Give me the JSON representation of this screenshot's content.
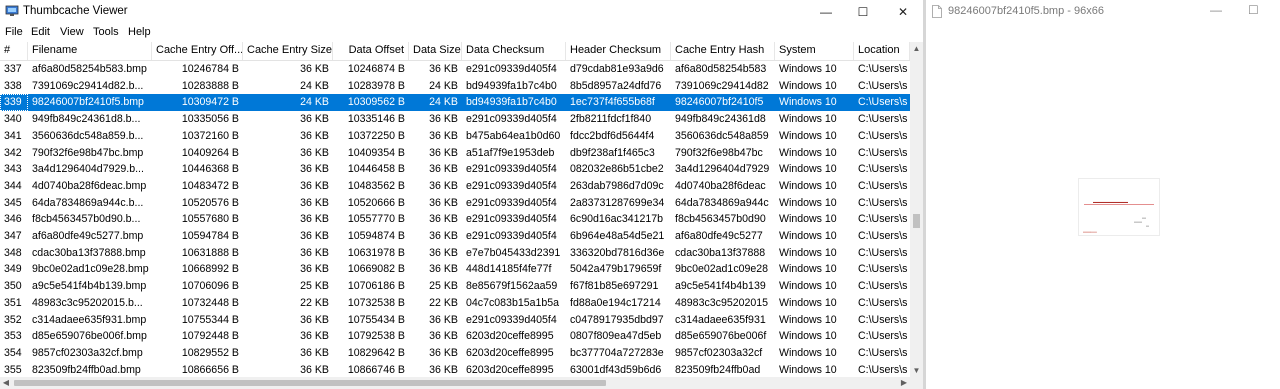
{
  "window": {
    "title": "Thumbcache Viewer",
    "minimize": "—",
    "maximize": "☐",
    "close": "✕"
  },
  "menu": [
    "File",
    "Edit",
    "View",
    "Tools",
    "Help"
  ],
  "columns": [
    "#",
    "Filename",
    "Cache Entry Off...",
    "Cache Entry Size",
    "Data Offset",
    "Data Size",
    "Data Checksum",
    "Header Checksum",
    "Cache Entry Hash",
    "System",
    "Location"
  ],
  "rows": [
    [
      "337",
      "af6a80d58254b583.bmp",
      "10246784 B",
      "36 KB",
      "10246874 B",
      "36 KB",
      "e291c09339d405f4",
      "d79cdab81e93a9d6",
      "af6a80d58254b583",
      "Windows 10",
      "C:\\Users\\s"
    ],
    [
      "338",
      "7391069c29414d82.b...",
      "10283888 B",
      "24 KB",
      "10283978 B",
      "24 KB",
      "bd94939fa1b7c4b0",
      "8b5d8957a24dfd76",
      "7391069c29414d82",
      "Windows 10",
      "C:\\Users\\s"
    ],
    [
      "339",
      "98246007bf2410f5.bmp",
      "10309472 B",
      "24 KB",
      "10309562 B",
      "24 KB",
      "bd94939fa1b7c4b0",
      "1ec737f4f655b68f",
      "98246007bf2410f5",
      "Windows 10",
      "C:\\Users\\s"
    ],
    [
      "340",
      "949fb849c24361d8.b...",
      "10335056 B",
      "36 KB",
      "10335146 B",
      "36 KB",
      "e291c09339d405f4",
      "2fb8211fdcf1f840",
      "949fb849c24361d8",
      "Windows 10",
      "C:\\Users\\s"
    ],
    [
      "341",
      "3560636dc548a859.b...",
      "10372160 B",
      "36 KB",
      "10372250 B",
      "36 KB",
      "b475ab64ea1b0d60",
      "fdcc2bdf6d5644f4",
      "3560636dc548a859",
      "Windows 10",
      "C:\\Users\\s"
    ],
    [
      "342",
      "790f32f6e98b47bc.bmp",
      "10409264 B",
      "36 KB",
      "10409354 B",
      "36 KB",
      "a51af7f9e1953deb",
      "db9f238af1f465c3",
      "790f32f6e98b47bc",
      "Windows 10",
      "C:\\Users\\s"
    ],
    [
      "343",
      "3a4d1296404d7929.b...",
      "10446368 B",
      "36 KB",
      "10446458 B",
      "36 KB",
      "e291c09339d405f4",
      "082032e86b51cbe2",
      "3a4d1296404d7929",
      "Windows 10",
      "C:\\Users\\s"
    ],
    [
      "344",
      "4d0740ba28f6deac.bmp",
      "10483472 B",
      "36 KB",
      "10483562 B",
      "36 KB",
      "e291c09339d405f4",
      "263dab7986d7d09c",
      "4d0740ba28f6deac",
      "Windows 10",
      "C:\\Users\\s"
    ],
    [
      "345",
      "64da7834869a944c.b...",
      "10520576 B",
      "36 KB",
      "10520666 B",
      "36 KB",
      "e291c09339d405f4",
      "2a83731287699e34",
      "64da7834869a944c",
      "Windows 10",
      "C:\\Users\\s"
    ],
    [
      "346",
      "f8cb4563457b0d90.b...",
      "10557680 B",
      "36 KB",
      "10557770 B",
      "36 KB",
      "e291c09339d405f4",
      "6c90d16ac341217b",
      "f8cb4563457b0d90",
      "Windows 10",
      "C:\\Users\\s"
    ],
    [
      "347",
      "af6a80dfe49c5277.bmp",
      "10594784 B",
      "36 KB",
      "10594874 B",
      "36 KB",
      "e291c09339d405f4",
      "6b964e48a54d5e21",
      "af6a80dfe49c5277",
      "Windows 10",
      "C:\\Users\\s"
    ],
    [
      "348",
      "cdac30ba13f37888.bmp",
      "10631888 B",
      "36 KB",
      "10631978 B",
      "36 KB",
      "e7e7b045433d2391",
      "336320bd7816d36e",
      "cdac30ba13f37888",
      "Windows 10",
      "C:\\Users\\s"
    ],
    [
      "349",
      "9bc0e02ad1c09e28.bmp",
      "10668992 B",
      "36 KB",
      "10669082 B",
      "36 KB",
      "448d14185f4fe77f",
      "5042a479b179659f",
      "9bc0e02ad1c09e28",
      "Windows 10",
      "C:\\Users\\s"
    ],
    [
      "350",
      "a9c5e541f4b4b139.bmp",
      "10706096 B",
      "25 KB",
      "10706186 B",
      "25 KB",
      "8e85679f1562aa59",
      "f67f81b85e697291",
      "a9c5e541f4b4b139",
      "Windows 10",
      "C:\\Users\\s"
    ],
    [
      "351",
      "48983c3c95202015.b...",
      "10732448 B",
      "22 KB",
      "10732538 B",
      "22 KB",
      "04c7c083b15a1b5a",
      "fd88a0e194c17214",
      "48983c3c95202015",
      "Windows 10",
      "C:\\Users\\s"
    ],
    [
      "352",
      "c314adaee635f931.bmp",
      "10755344 B",
      "36 KB",
      "10755434 B",
      "36 KB",
      "e291c09339d405f4",
      "c0478917935dbd97",
      "c314adaee635f931",
      "Windows 10",
      "C:\\Users\\s"
    ],
    [
      "353",
      "d85e659076be006f.bmp",
      "10792448 B",
      "36 KB",
      "10792538 B",
      "36 KB",
      "6203d20ceffe8995",
      "0807f809ea47d5eb",
      "d85e659076be006f",
      "Windows 10",
      "C:\\Users\\s"
    ],
    [
      "354",
      "9857cf02303a32cf.bmp",
      "10829552 B",
      "36 KB",
      "10829642 B",
      "36 KB",
      "6203d20ceffe8995",
      "bc377704a727283e",
      "9857cf02303a32cf",
      "Windows 10",
      "C:\\Users\\s"
    ],
    [
      "355",
      "823509fb24ffb0ad.bmp",
      "10866656 B",
      "36 KB",
      "10866746 B",
      "36 KB",
      "6203d20ceffe8995",
      "63001df43d59b6d6",
      "823509fb24ffb0ad",
      "Windows 10",
      "C:\\Users\\s"
    ]
  ],
  "selected_row": "339",
  "viewer": {
    "title": "98246007bf2410f5.bmp - 96x66",
    "minimize": "—",
    "maximize": "☐"
  },
  "colors": {
    "selection": "#0078d7",
    "selection_text": "#ffffff"
  }
}
